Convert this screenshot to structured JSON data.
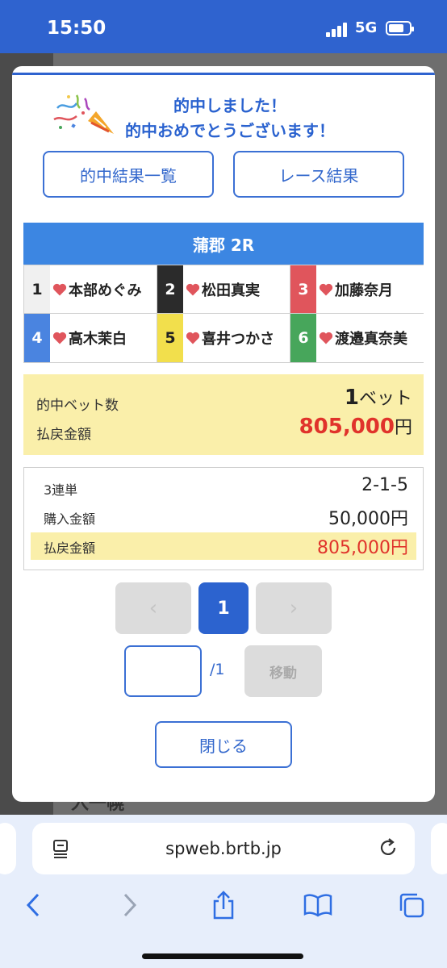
{
  "status_bar": {
    "time": "15:50",
    "network": "5G"
  },
  "background": {
    "fragment": "入一幌"
  },
  "modal": {
    "congrats_line1": "的中しました！",
    "congrats_line2": "的中おめでとうございます！",
    "buttons": {
      "hit_list": "的中結果一覧",
      "race_result": "レース結果"
    },
    "race_header": "蒲郡 2R",
    "racers": [
      {
        "number": "1",
        "name": "本部めぐみ",
        "bg": "#f0f0f0",
        "fg": "#222222"
      },
      {
        "number": "2",
        "name": "松田真実",
        "bg": "#2b2b2b",
        "fg": "#ffffff"
      },
      {
        "number": "3",
        "name": "加藤奈月",
        "bg": "#e0555c",
        "fg": "#ffffff"
      },
      {
        "number": "4",
        "name": "高木茉白",
        "bg": "#4a84e0",
        "fg": "#ffffff"
      },
      {
        "number": "5",
        "name": "喜井つかさ",
        "bg": "#f2df4c",
        "fg": "#222222"
      },
      {
        "number": "6",
        "name": "渡邉真奈美",
        "bg": "#47a65b",
        "fg": "#ffffff"
      }
    ],
    "summary": {
      "hit_bets_label": "的中ベット数",
      "hit_bets_value": "1",
      "hit_bets_unit": "ベット",
      "payout_label": "払戻金額",
      "payout_value": "805,000",
      "payout_unit": "円"
    },
    "detail": {
      "bet_type_label": "3連単",
      "bet_type_value": "2-1-5",
      "purchase_label": "購入金額",
      "purchase_value": "50,000円",
      "payout_label": "払戻金額",
      "payout_value": "805,000円"
    },
    "pagination": {
      "prev": "‹",
      "current": "1",
      "next": "›",
      "total": "/1",
      "go_label": "移動"
    },
    "close_label": "閉じる"
  },
  "browser": {
    "url": "spweb.brtb.jp"
  },
  "colors": {
    "accent": "#2f63cf",
    "payout_red": "#e0332b",
    "highlight": "#faefaa",
    "heart": "#e0555c"
  }
}
